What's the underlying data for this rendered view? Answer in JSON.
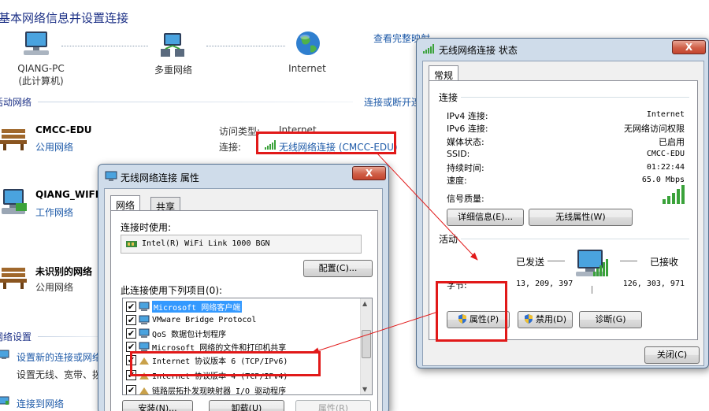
{
  "background": {
    "title": "基本网络信息并设置连接",
    "view_full_map": "查看完整映射",
    "nodes": [
      {
        "label_line1": "QIANG-PC",
        "label_line2": "(此计算机)"
      },
      {
        "label_line1": "多重网络"
      },
      {
        "label_line1": "Internet"
      }
    ],
    "active_networks_header": "活动网络",
    "connect_disconnect": "连接或断开连接",
    "networks": [
      {
        "name": "CMCC-EDU",
        "type": "公用网络"
      },
      {
        "name": "QIANG_WIFI",
        "type": "工作网络"
      },
      {
        "name": "未识别的网络",
        "type": "公用网络"
      }
    ],
    "access_type_label": "访问类型:",
    "access_type_value": "Internet",
    "connection_label": "连接:",
    "connection_value": "无线网络连接 (CMCC-EDU)",
    "change_settings_header": "网络设置",
    "setup_new_connection": "设置新的连接或网络",
    "setup_desc": "设置无线、宽带、拨",
    "connect_to_network": "连接到网络"
  },
  "properties_dialog": {
    "title": "无线网络连接 属性",
    "close_label": "X",
    "tabs": [
      {
        "label": "网络"
      },
      {
        "label": "共享"
      }
    ],
    "connect_using_label": "连接时使用:",
    "adapter_name": "Intel(R) WiFi Link 1000 BGN",
    "configure_button": "配置(C)...",
    "items_label": "此连接使用下列项目(0):",
    "items": [
      {
        "label": "Microsoft 网络客户端",
        "checked": "✔",
        "selected": true
      },
      {
        "label": "VMware Bridge Protocol",
        "checked": "✔"
      },
      {
        "label": "QoS 数据包计划程序",
        "checked": "✔"
      },
      {
        "label": "Microsoft 网络的文件和打印机共享",
        "checked": "✔"
      },
      {
        "label": "Internet 协议版本 6 (TCP/IPv6)",
        "checked": "✔"
      },
      {
        "label": "Internet 协议版本 4 (TCP/IPv4)",
        "checked": "✔"
      },
      {
        "label": "链路层拓扑发现映射器 I/O 驱动程序",
        "checked": "✔"
      }
    ],
    "install_button": "安装(N)...",
    "uninstall_button": "卸载(U)",
    "properties_button": "属性(R)"
  },
  "status_dialog": {
    "title": "无线网络连接 状态",
    "close_label": "X",
    "tab_label": "常规",
    "connection_group": "连接",
    "rows": [
      {
        "label": "IPv4 连接:",
        "value": "Internet"
      },
      {
        "label": "IPv6 连接:",
        "value": "无网络访问权限"
      },
      {
        "label": "媒体状态:",
        "value": "已启用"
      },
      {
        "label": "SSID:",
        "value": "CMCC-EDU"
      },
      {
        "label": "持续时间:",
        "value": "01:22:44"
      },
      {
        "label": "速度:",
        "value": "65.0 Mbps"
      }
    ],
    "signal_quality_label": "信号质量:",
    "details_button": "详细信息(E)...",
    "wireless_props_button": "无线属性(W)",
    "activity_group": "活动",
    "sent_label": "已发送",
    "received_label": "已接收",
    "bytes_label": "字节:",
    "bytes_sent": "13, 209, 397",
    "bytes_received": "126, 303, 971",
    "properties_button": "属性(P)",
    "disable_button": "禁用(D)",
    "diagnose_button": "诊断(G)",
    "close_button": "关闭(C)"
  },
  "colors": {
    "annotation_red": "#e11919",
    "link_blue": "#1e5aa8",
    "selection_blue": "#3399ff",
    "signal_green": "#3aa23a"
  }
}
